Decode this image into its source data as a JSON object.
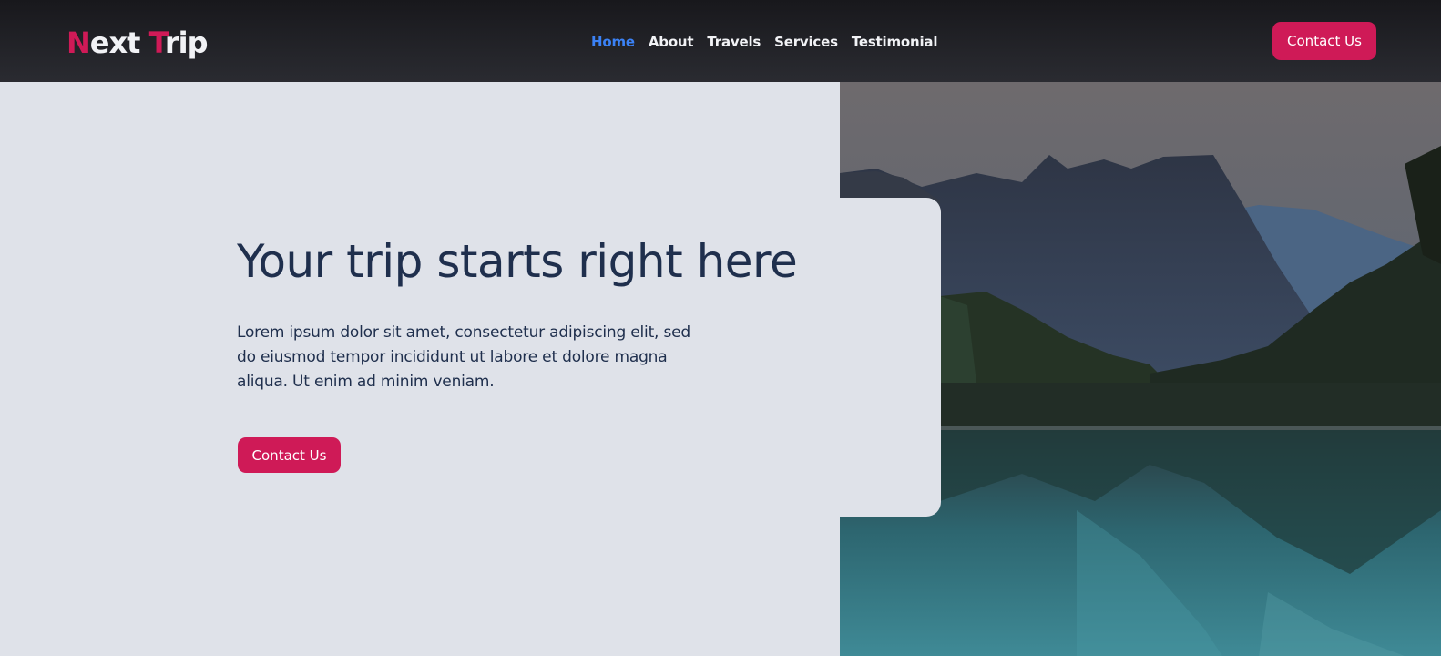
{
  "header": {
    "logo": {
      "first_initial": "N",
      "first_rest": "ext",
      "second_initial": "T",
      "second_rest": "rip"
    },
    "nav": {
      "home": "Home",
      "about": "About",
      "travels": "Travels",
      "services": "Services",
      "testimonial": "Testimonial"
    },
    "active_item": "Home",
    "contact_button": "Contact Us"
  },
  "hero": {
    "title": "Your trip starts right here",
    "text": "Lorem ipsum dolor sit amet, consectetur adipiscing elit, sed do eiusmod tempor incididunt ut labore et dolore magna aliqua. Ut enim ad minim veniam.",
    "button": "Contact Us",
    "image": "mountain-lake-photo"
  },
  "colors": {
    "accent": "#cf1a57",
    "active_link": "#3b82f6",
    "header_bg": "#1c1c21",
    "page_bg": "#dfe2e9",
    "heading": "#1f2f4d"
  }
}
